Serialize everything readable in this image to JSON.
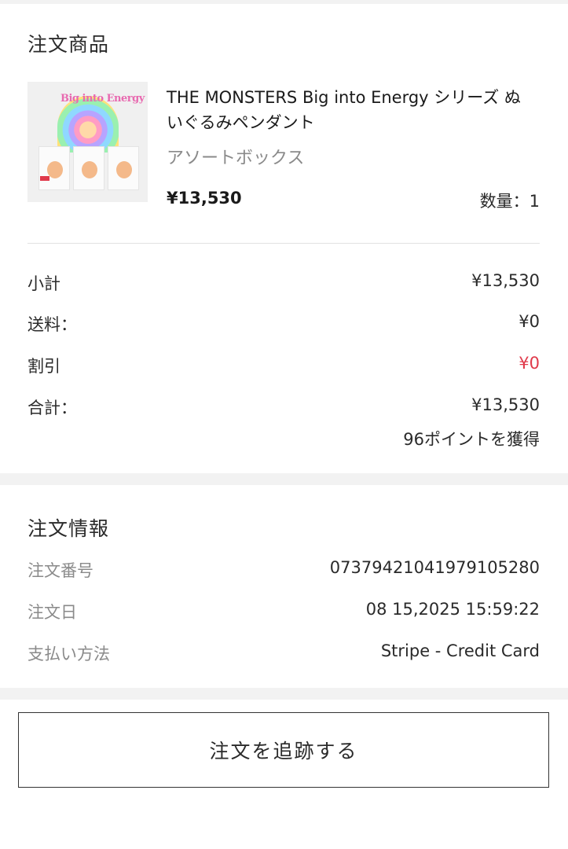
{
  "order_items": {
    "title": "注文商品",
    "product": {
      "name_line1": "THE MONSTERS Big into Energy シリーズ ぬ",
      "name_line2": "いぐるみペンダント",
      "variant": "アソートボックス",
      "price": "¥13,530",
      "quantity": "数量：1",
      "image_logo_text": "Big into Energy",
      "image_icon": "product-thumbnail-icon"
    }
  },
  "summary": {
    "subtotal_label": "小計",
    "subtotal_value": "¥13,530",
    "shipping_label": "送料：",
    "shipping_value": "¥0",
    "discount_label": "割引",
    "discount_value": "¥0",
    "total_label": "合計：",
    "total_value": "¥13,530",
    "points": "96ポイントを獲得"
  },
  "order_info": {
    "title": "注文情報",
    "number_label": "注文番号",
    "number_value": "07379421041979105280",
    "date_label": "注文日",
    "date_value": "08 15,2025 15:59:22",
    "payment_label": "支払い方法",
    "payment_value": "Stripe - Credit Card"
  },
  "actions": {
    "track_label": "注文を追跡する"
  },
  "colors": {
    "accent_red": "#e0394a",
    "band_gray": "#f2f2f2"
  }
}
